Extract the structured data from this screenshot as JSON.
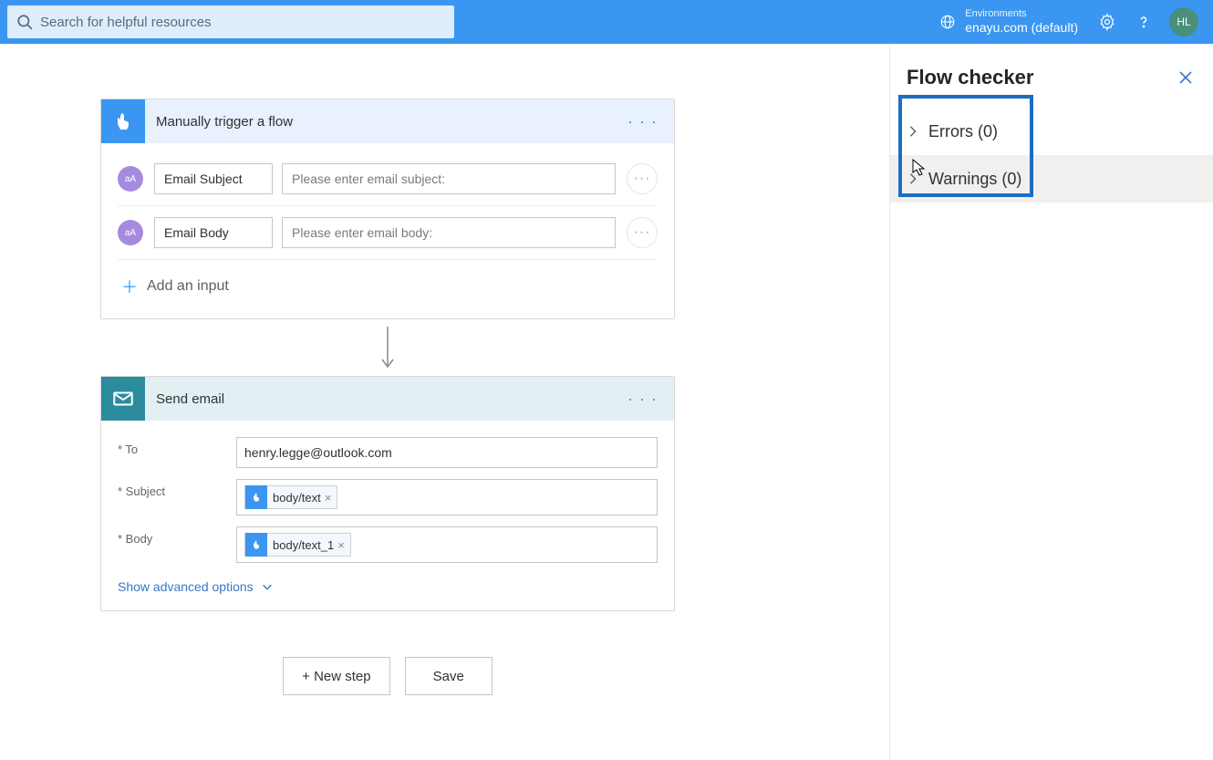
{
  "topbar": {
    "search_placeholder": "Search for helpful resources",
    "env_label": "Environments",
    "env_name": "enayu.com (default)",
    "avatar_initials": "HL"
  },
  "trigger": {
    "title": "Manually trigger a flow",
    "inputs": [
      {
        "label": "Email Subject",
        "placeholder": "Please enter email subject:",
        "badge": "aA"
      },
      {
        "label": "Email Body",
        "placeholder": "Please enter email body:",
        "badge": "aA"
      }
    ],
    "add_input_label": "Add an input"
  },
  "send_email": {
    "title": "Send email",
    "fields": {
      "to_label": "* To",
      "to_value": "henry.legge@outlook.com",
      "subject_label": "* Subject",
      "subject_token": "body/text",
      "body_label": "* Body",
      "body_token": "body/text_1"
    },
    "advanced_label": "Show advanced options"
  },
  "actions": {
    "new_step": "+ New step",
    "save": "Save"
  },
  "panel": {
    "title": "Flow checker",
    "errors_label": "Errors (0)",
    "warnings_label": "Warnings (0)"
  }
}
